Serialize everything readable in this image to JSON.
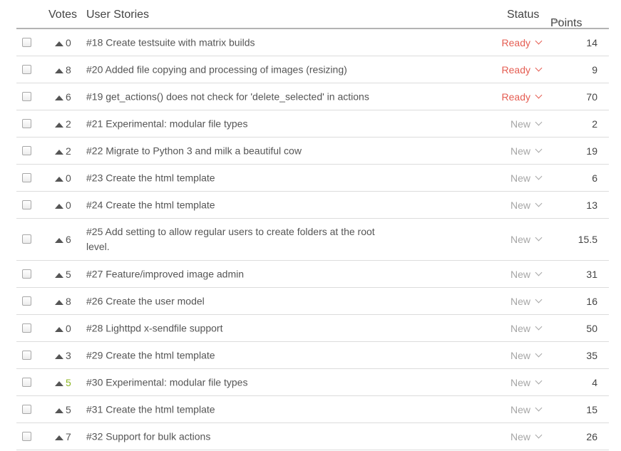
{
  "header": {
    "votes": "Votes",
    "stories": "User Stories",
    "status": "Status",
    "points": "Points"
  },
  "colors": {
    "ready": "#e55d52",
    "new": "#a6a6a6",
    "voted": "#8cb623",
    "text": "#555555"
  },
  "rows": [
    {
      "votes": "0",
      "story": "#18 Create testsuite with matrix builds",
      "status": "Ready",
      "points": "14",
      "voted": false
    },
    {
      "votes": "8",
      "story": "#20 Added file copying and processing of images (resizing)",
      "status": "Ready",
      "points": "9",
      "voted": false
    },
    {
      "votes": "6",
      "story": "#19 get_actions() does not check for 'delete_selected' in actions",
      "status": "Ready",
      "points": "70",
      "voted": false
    },
    {
      "votes": "2",
      "story": "#21 Experimental: modular file types",
      "status": "New",
      "points": "2",
      "voted": false
    },
    {
      "votes": "2",
      "story": "#22 Migrate to Python 3 and milk a beautiful cow",
      "status": "New",
      "points": "19",
      "voted": false
    },
    {
      "votes": "0",
      "story": "#23 Create the html template",
      "status": "New",
      "points": "6",
      "voted": false
    },
    {
      "votes": "0",
      "story": "#24 Create the html template",
      "status": "New",
      "points": "13",
      "voted": false
    },
    {
      "votes": "6",
      "story": "#25 Add setting to allow regular users to create folders at the root level.",
      "status": "New",
      "points": "15.5",
      "voted": false,
      "tall": true
    },
    {
      "votes": "5",
      "story": "#27 Feature/improved image admin",
      "status": "New",
      "points": "31",
      "voted": false
    },
    {
      "votes": "8",
      "story": "#26 Create the user model",
      "status": "New",
      "points": "16",
      "voted": false
    },
    {
      "votes": "0",
      "story": "#28 Lighttpd x-sendfile support",
      "status": "New",
      "points": "50",
      "voted": false
    },
    {
      "votes": "3",
      "story": "#29 Create the html template",
      "status": "New",
      "points": "35",
      "voted": false
    },
    {
      "votes": "5",
      "story": "#30 Experimental: modular file types",
      "status": "New",
      "points": "4",
      "voted": true
    },
    {
      "votes": "5",
      "story": "#31 Create the html template",
      "status": "New",
      "points": "15",
      "voted": false
    },
    {
      "votes": "7",
      "story": "#32 Support for bulk actions",
      "status": "New",
      "points": "26",
      "voted": false
    }
  ]
}
